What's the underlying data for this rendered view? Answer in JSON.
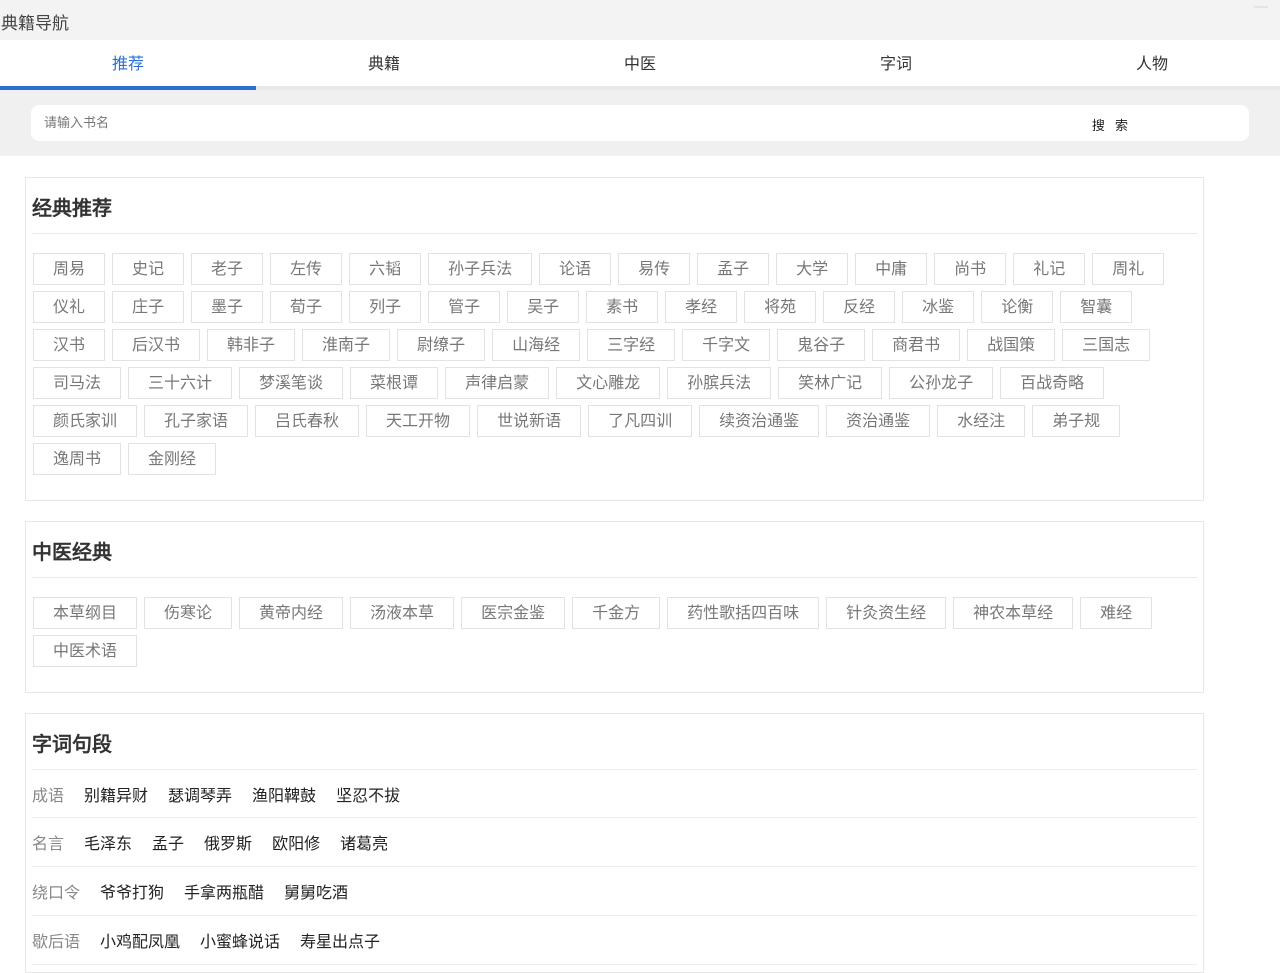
{
  "app": {
    "title": "典籍导航"
  },
  "tabs": [
    {
      "label": "推荐",
      "active": true
    },
    {
      "label": "典籍",
      "active": false
    },
    {
      "label": "中医",
      "active": false
    },
    {
      "label": "字词",
      "active": false
    },
    {
      "label": "人物",
      "active": false
    }
  ],
  "search": {
    "placeholder": "请输入书名",
    "value": "",
    "button_label": "搜 索"
  },
  "classics": {
    "title": "经典推荐",
    "items": [
      "周易",
      "史记",
      "老子",
      "左传",
      "六韬",
      "孙子兵法",
      "论语",
      "易传",
      "孟子",
      "大学",
      "中庸",
      "尚书",
      "礼记",
      "周礼",
      "仪礼",
      "庄子",
      "墨子",
      "荀子",
      "列子",
      "管子",
      "吴子",
      "素书",
      "孝经",
      "将苑",
      "反经",
      "冰鉴",
      "论衡",
      "智囊",
      "汉书",
      "后汉书",
      "韩非子",
      "淮南子",
      "尉缭子",
      "山海经",
      "三字经",
      "千字文",
      "鬼谷子",
      "商君书",
      "战国策",
      "三国志",
      "司马法",
      "三十六计",
      "梦溪笔谈",
      "菜根谭",
      "声律启蒙",
      "文心雕龙",
      "孙膑兵法",
      "笑林广记",
      "公孙龙子",
      "百战奇略",
      "颜氏家训",
      "孔子家语",
      "吕氏春秋",
      "天工开物",
      "世说新语",
      "了凡四训",
      "续资治通鉴",
      "资治通鉴",
      "水经注",
      "弟子规",
      "逸周书",
      "金刚经"
    ]
  },
  "medicine": {
    "title": "中医经典",
    "items": [
      "本草纲目",
      "伤寒论",
      "黄帝内经",
      "汤液本草",
      "医宗金鉴",
      "千金方",
      "药性歌括四百味",
      "针灸资生经",
      "神农本草经",
      "难经",
      "中医术语"
    ]
  },
  "words": {
    "title": "字词句段",
    "rows": [
      {
        "label": "成语",
        "items": [
          "别籍异财",
          "瑟调琴弄",
          "渔阳鞞鼓",
          "坚忍不拔"
        ]
      },
      {
        "label": "名言",
        "items": [
          "毛泽东",
          "孟子",
          "俄罗斯",
          "欧阳修",
          "诸葛亮"
        ]
      },
      {
        "label": "绕口令",
        "items": [
          "爷爷打狗",
          "手拿两瓶醋",
          "舅舅吃酒"
        ]
      },
      {
        "label": "歇后语",
        "items": [
          "小鸡配凤凰",
          "小蜜蜂说话",
          "寿星出点子"
        ]
      }
    ]
  }
}
